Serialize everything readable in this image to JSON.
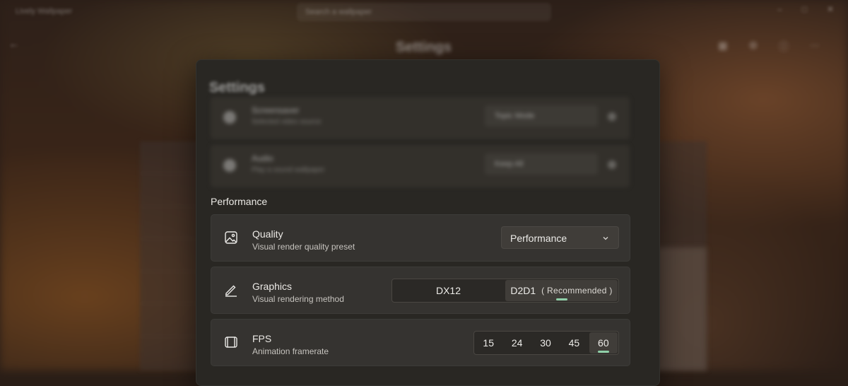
{
  "background": {
    "app_name": "Lively Wallpaper",
    "search_placeholder": "Search a wallpaper",
    "window_buttons": [
      "–",
      "□",
      "✕"
    ],
    "page_title": "Settings"
  },
  "dialog": {
    "title": "Settings",
    "blurred_cards": [
      {
        "title": "Screensaver",
        "subtitle": "Selected video source",
        "combo": "Topic Mode"
      },
      {
        "title": "Audio",
        "subtitle": "Play a sound wallpaper",
        "combo": "Keep All"
      }
    ]
  },
  "performance": {
    "header": "Performance",
    "quality": {
      "icon": "image-icon",
      "title": "Quality",
      "subtitle": "Visual render quality preset",
      "selected": "Performance"
    },
    "graphics": {
      "icon": "pen-icon",
      "title": "Graphics",
      "subtitle": "Visual rendering method",
      "options": [
        "DX12",
        "D2D1"
      ],
      "recommended_label": "( Recommended )",
      "selected": "D2D1"
    },
    "fps": {
      "icon": "window-icon",
      "title": "FPS",
      "subtitle": "Animation framerate",
      "options": [
        "15",
        "24",
        "30",
        "45",
        "60"
      ],
      "selected": "60"
    }
  },
  "colors": {
    "accent": "#8fcfa8",
    "card_bg": "#353330",
    "dialog_bg": "#292723"
  }
}
